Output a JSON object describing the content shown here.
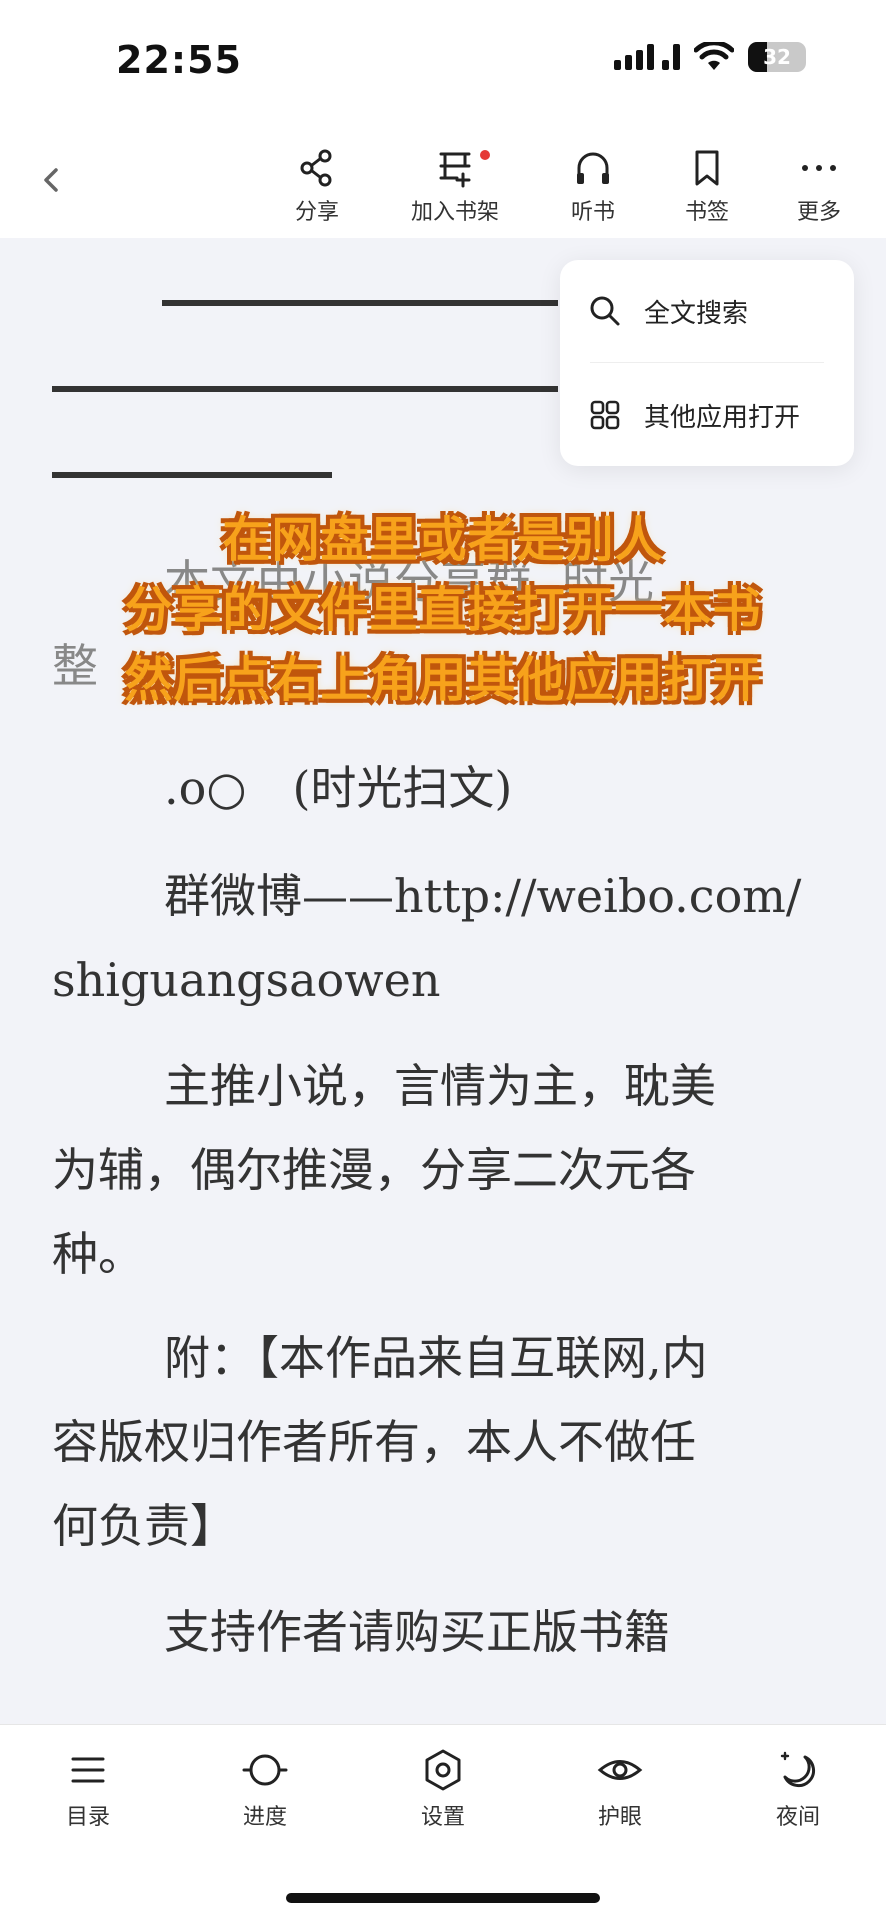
{
  "status_bar": {
    "time": "22:55",
    "battery": "32",
    "battery_level": 0.32
  },
  "toolbar": {
    "share": "分享",
    "add_shelf": "加入书架",
    "listen": "听书",
    "bookmark": "书签",
    "more": "更多"
  },
  "menu": {
    "search": "全文搜索",
    "open_other": "其他应用打开"
  },
  "content": {
    "line_a1": "本文由小说分享群",
    "line_a2": "时光",
    "line_a3": "整",
    "line_b": ".o○　(时光扫文)",
    "line_c1": "群微博——http://weibo.com/",
    "line_c2": "shiguangsaowen",
    "line_d1": "主推小说，言情为主，耽美",
    "line_d2": "为辅，偶尔推漫，分享二次元各",
    "line_d3": "种。",
    "line_e1": "附：【本作品来自互联网,内",
    "line_e2": "容版权归作者所有，本人不做任",
    "line_e3": "何负责】",
    "line_f": "支持作者请购买正版书籍"
  },
  "caption": {
    "line1": "在网盘里或者是别人",
    "line2": "分享的文件里直接打开一本书",
    "line3": "然后点右上角用其他应用打开"
  },
  "bottom_bar": {
    "toc": "目录",
    "progress": "进度",
    "settings": "设置",
    "eye_care": "护眼",
    "night": "夜间"
  }
}
